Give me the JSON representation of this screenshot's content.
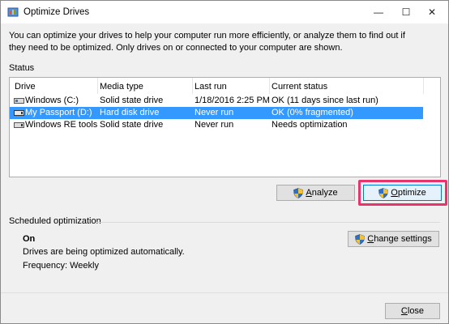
{
  "window": {
    "title": "Optimize Drives",
    "controls": {
      "minimize": "—",
      "maximize": "☐",
      "close": "✕"
    }
  },
  "description": "You can optimize your drives to help your computer run more efficiently, or analyze them to find out if they need to be optimized. Only drives on or connected to your computer are shown.",
  "status": {
    "label": "Status",
    "columns": [
      "Drive",
      "Media type",
      "Last run",
      "Current status"
    ],
    "rows": [
      {
        "drive": "Windows (C:)",
        "media": "Solid state drive",
        "last_run": "1/18/2016 2:25 PM",
        "status": "OK (11 days since last run)",
        "selected": false
      },
      {
        "drive": "My Passport (D:)",
        "media": "Hard disk drive",
        "last_run": "Never run",
        "status": "OK (0% fragmented)",
        "selected": true
      },
      {
        "drive": "Windows RE tools",
        "media": "Solid state drive",
        "last_run": "Never run",
        "status": "Needs optimization",
        "selected": false
      }
    ]
  },
  "buttons": {
    "analyze_hot": "A",
    "analyze_rest": "nalyze",
    "optimize_hot": "O",
    "optimize_rest": "ptimize",
    "change_hot": "C",
    "change_rest": "hange settings",
    "close_hot": "C",
    "close_rest": "lose"
  },
  "scheduled": {
    "label": "Scheduled optimization",
    "state": "On",
    "info": "Drives are being optimized automatically.",
    "frequency": "Frequency: Weekly"
  },
  "colors": {
    "selection": "#3399ff",
    "highlight_box": "#e8336d",
    "window_bg": "#f0f0f0"
  }
}
